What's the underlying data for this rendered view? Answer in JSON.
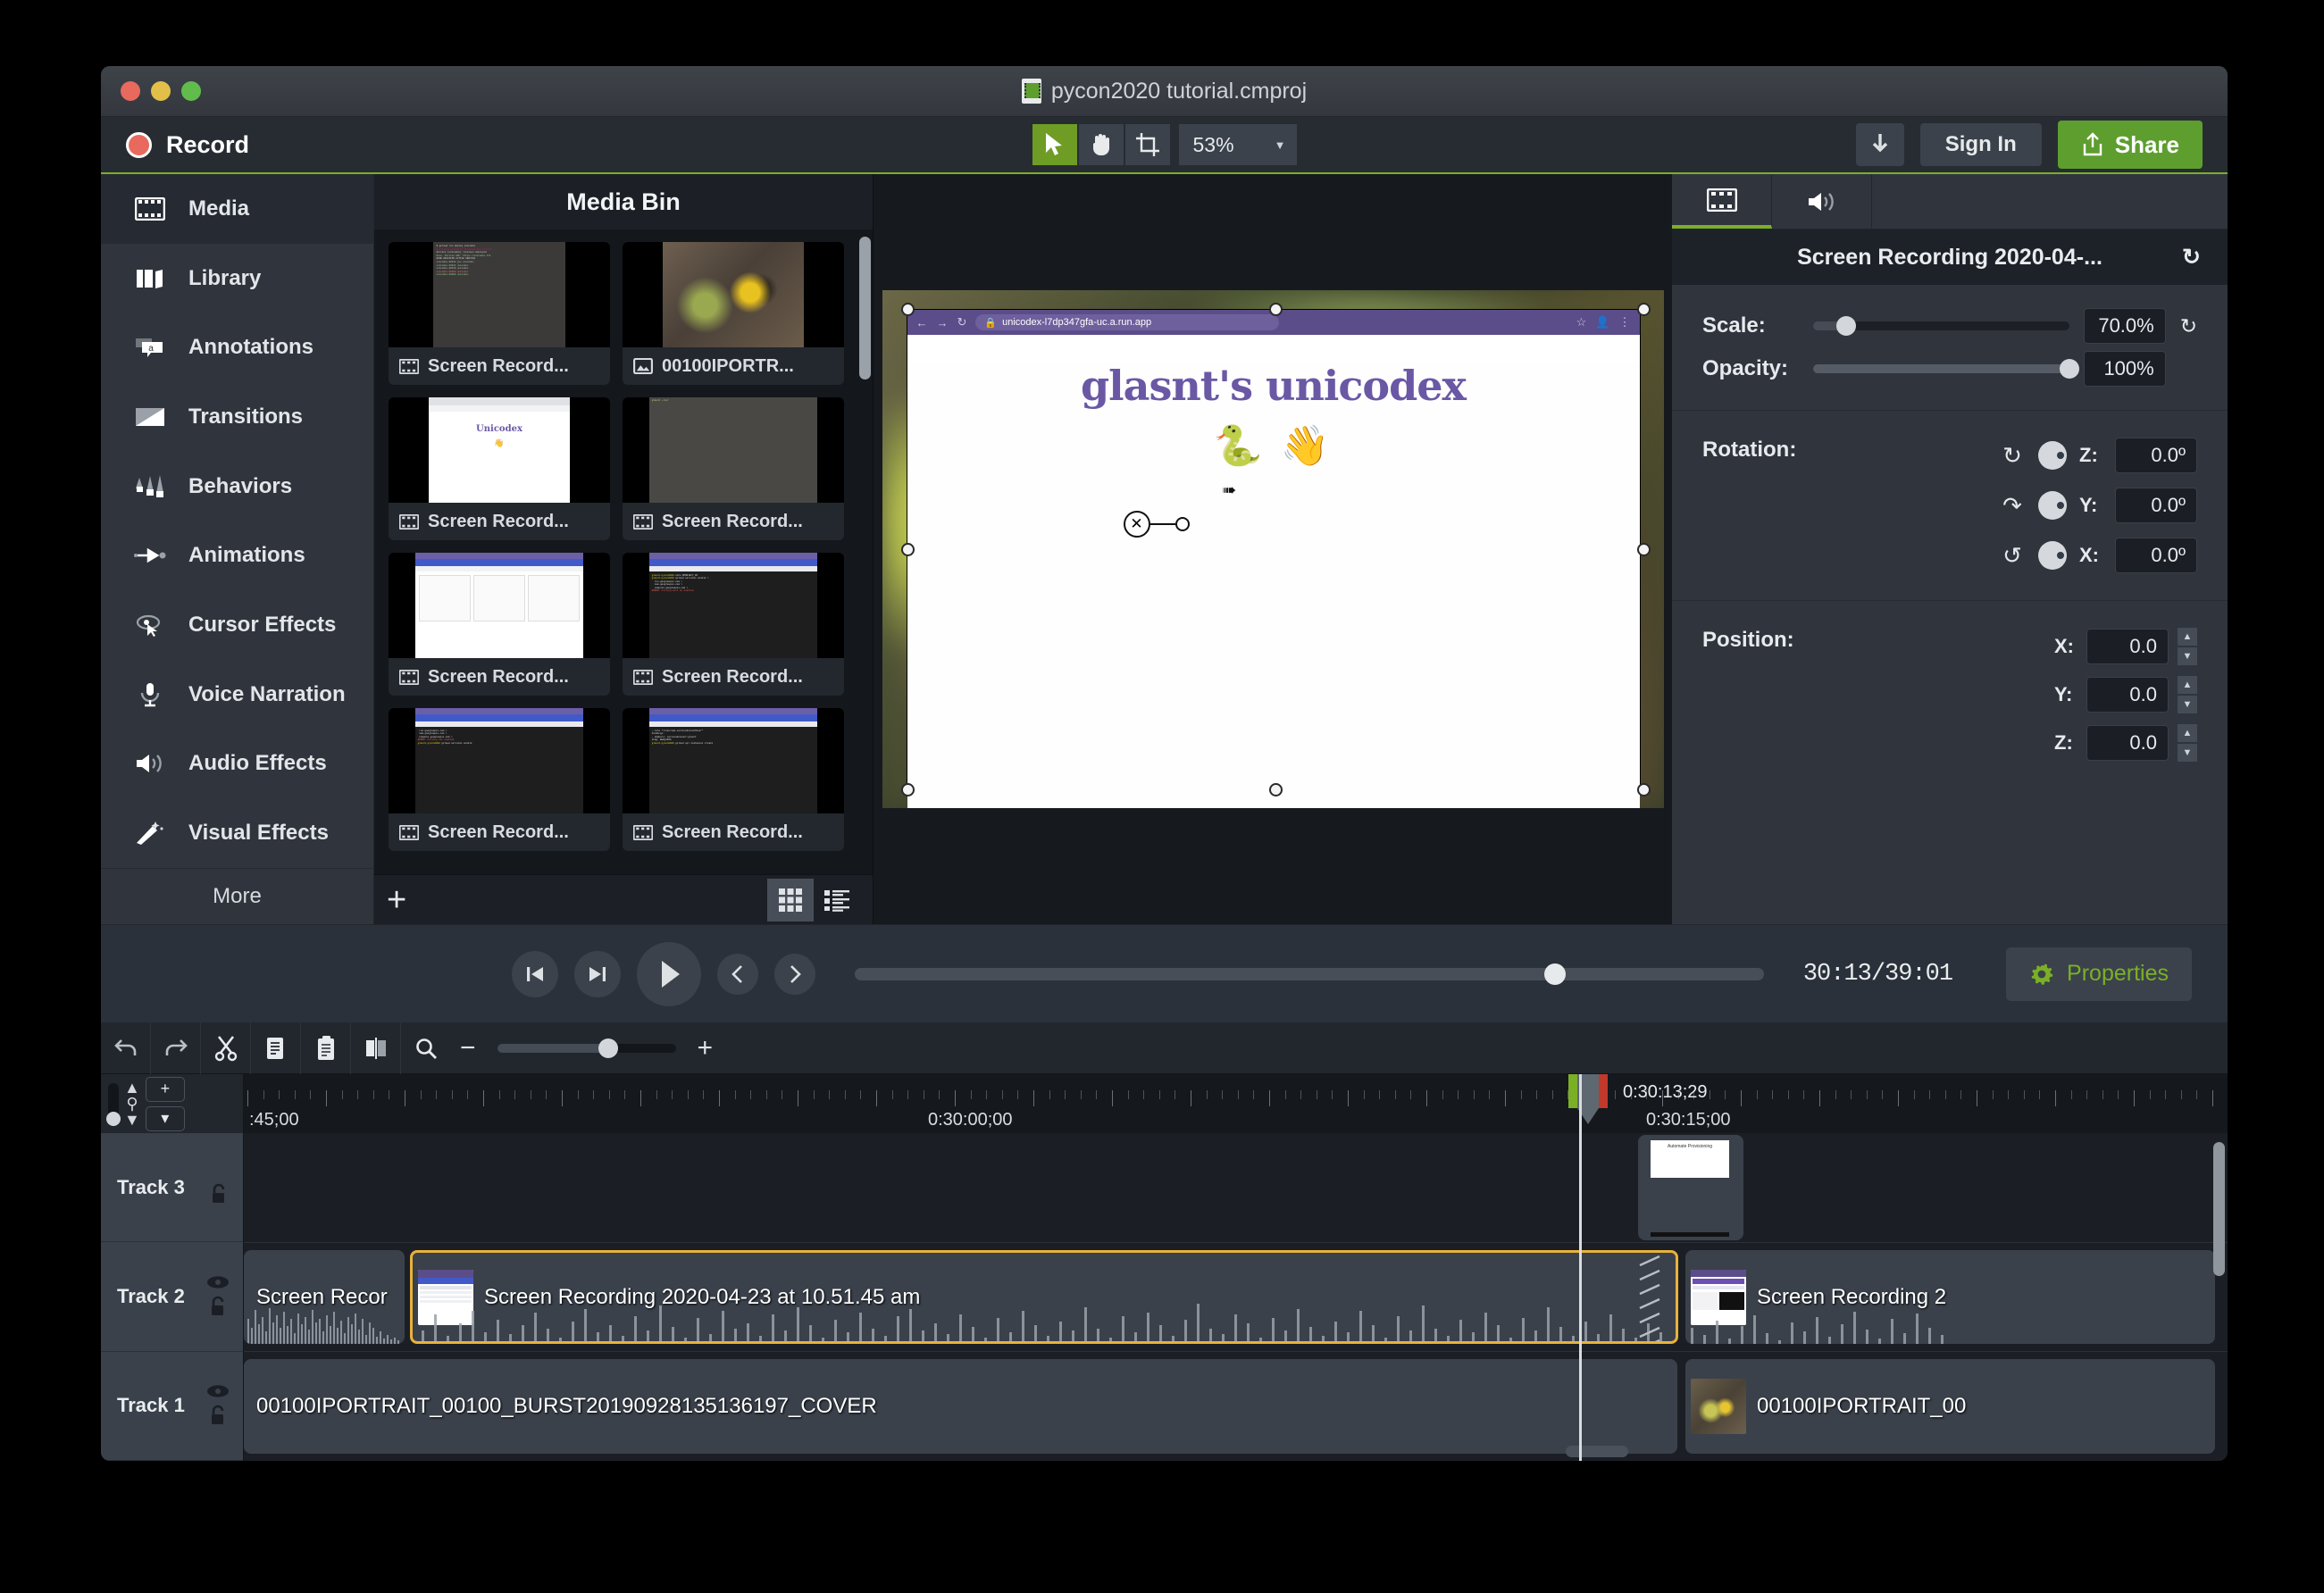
{
  "window": {
    "title": "pycon2020 tutorial.cmproj"
  },
  "toolbar": {
    "record_label": "Record",
    "zoom_value": "53%",
    "signin_label": "Sign In",
    "share_label": "Share",
    "tools": [
      {
        "name": "pointer-tool",
        "active": true
      },
      {
        "name": "hand-tool",
        "active": false
      },
      {
        "name": "crop-tool",
        "active": false
      }
    ]
  },
  "sidebar": {
    "items": [
      {
        "label": "Media",
        "icon": "film-icon",
        "active": true
      },
      {
        "label": "Library",
        "icon": "library-icon",
        "active": false
      },
      {
        "label": "Annotations",
        "icon": "annotation-icon",
        "active": false
      },
      {
        "label": "Transitions",
        "icon": "transition-icon",
        "active": false
      },
      {
        "label": "Behaviors",
        "icon": "behaviors-icon",
        "active": false
      },
      {
        "label": "Animations",
        "icon": "animations-icon",
        "active": false
      },
      {
        "label": "Cursor Effects",
        "icon": "cursor-effects-icon",
        "active": false
      },
      {
        "label": "Voice Narration",
        "icon": "microphone-icon",
        "active": false
      },
      {
        "label": "Audio Effects",
        "icon": "speaker-icon",
        "active": false
      },
      {
        "label": "Visual Effects",
        "icon": "wand-icon",
        "active": false
      }
    ],
    "more_label": "More"
  },
  "media_bin": {
    "title": "Media Bin",
    "items": [
      {
        "label": "Screen Record...",
        "icon": "film-icon",
        "thumb": "terminal"
      },
      {
        "label": "00100IPORTR...",
        "icon": "image-icon",
        "thumb": "flower"
      },
      {
        "label": "Screen Record...",
        "icon": "film-icon",
        "thumb": "unicodex"
      },
      {
        "label": "Screen Record...",
        "icon": "film-icon",
        "thumb": "dark"
      },
      {
        "label": "Screen Record...",
        "icon": "film-icon",
        "thumb": "gcp-console"
      },
      {
        "label": "Screen Record...",
        "icon": "film-icon",
        "thumb": "gcp-terminal"
      },
      {
        "label": "Screen Record...",
        "icon": "film-icon",
        "thumb": "gcp-terminal2"
      },
      {
        "label": "Screen Record...",
        "icon": "film-icon",
        "thumb": "gcp-terminal3"
      }
    ],
    "add_label": "+",
    "views": [
      {
        "name": "grid-view",
        "active": true
      },
      {
        "name": "list-view",
        "active": false
      }
    ]
  },
  "canvas": {
    "browser_url": "unicodex-l7dp347gfa-uc.a.run.app",
    "page_title": "glasnt's unicodex",
    "page_emoji": "🐍 👋"
  },
  "properties": {
    "tabs": [
      {
        "name": "video-properties-tab",
        "icon": "film-icon",
        "active": true
      },
      {
        "name": "audio-properties-tab",
        "icon": "speaker-icon",
        "active": false
      }
    ],
    "clip_title": "Screen Recording 2020-04-...",
    "reset_icon": "reset-icon",
    "scale_label": "Scale:",
    "scale_value": "70.0%",
    "opacity_label": "Opacity:",
    "opacity_value": "100%",
    "rotation_label": "Rotation:",
    "rotation": [
      {
        "axis": "Z:",
        "value": "0.0º"
      },
      {
        "axis": "Y:",
        "value": "0.0º"
      },
      {
        "axis": "X:",
        "value": "0.0º"
      }
    ],
    "position_label": "Position:",
    "position": [
      {
        "axis": "X:",
        "value": "0.0"
      },
      {
        "axis": "Y:",
        "value": "0.0"
      },
      {
        "axis": "Z:",
        "value": "0.0"
      }
    ]
  },
  "transport": {
    "timecode": "30:13/39:01",
    "properties_label": "Properties",
    "buttons": [
      {
        "name": "step-back-button"
      },
      {
        "name": "step-forward-button"
      },
      {
        "name": "play-button"
      },
      {
        "name": "previous-button"
      },
      {
        "name": "next-button"
      }
    ]
  },
  "timeline": {
    "tools": [
      {
        "name": "undo-button",
        "icon": "undo-icon"
      },
      {
        "name": "redo-button",
        "icon": "redo-icon"
      },
      {
        "name": "cut-button",
        "icon": "scissors-icon"
      },
      {
        "name": "copy-button",
        "icon": "copy-icon"
      },
      {
        "name": "paste-button",
        "icon": "paste-icon"
      },
      {
        "name": "split-button",
        "icon": "split-icon"
      },
      {
        "name": "zoom-button",
        "icon": "magnifier-icon"
      }
    ],
    "ruler_labels": [
      ":45;00",
      "0:30:00;00",
      "0:30:15;00"
    ],
    "playhead_time": "0:30:13;29",
    "tracks": [
      {
        "label": "Track 3"
      },
      {
        "label": "Track 2"
      },
      {
        "label": "Track 1"
      }
    ],
    "clips": {
      "track3": [
        {
          "label": "Automate Provisioning"
        }
      ],
      "track2": [
        {
          "label": "Screen Recor",
          "selected": false
        },
        {
          "label": "Screen Recording 2020-04-23 at 10.51.45 am",
          "selected": true
        },
        {
          "label": "Screen Recording 2",
          "selected": false
        }
      ],
      "track1": [
        {
          "label": "00100IPORTRAIT_00100_BURST20190928135136197_COVER",
          "selected": false
        },
        {
          "label": "00100IPORTRAIT_00",
          "selected": false
        }
      ]
    }
  },
  "colors": {
    "accent_green": "#7bb026",
    "share_green": "#5d9e2f",
    "selected_clip": "#e8b23a",
    "panel_bg": "#2f343d",
    "timeline_bg": "#1b1f25"
  }
}
